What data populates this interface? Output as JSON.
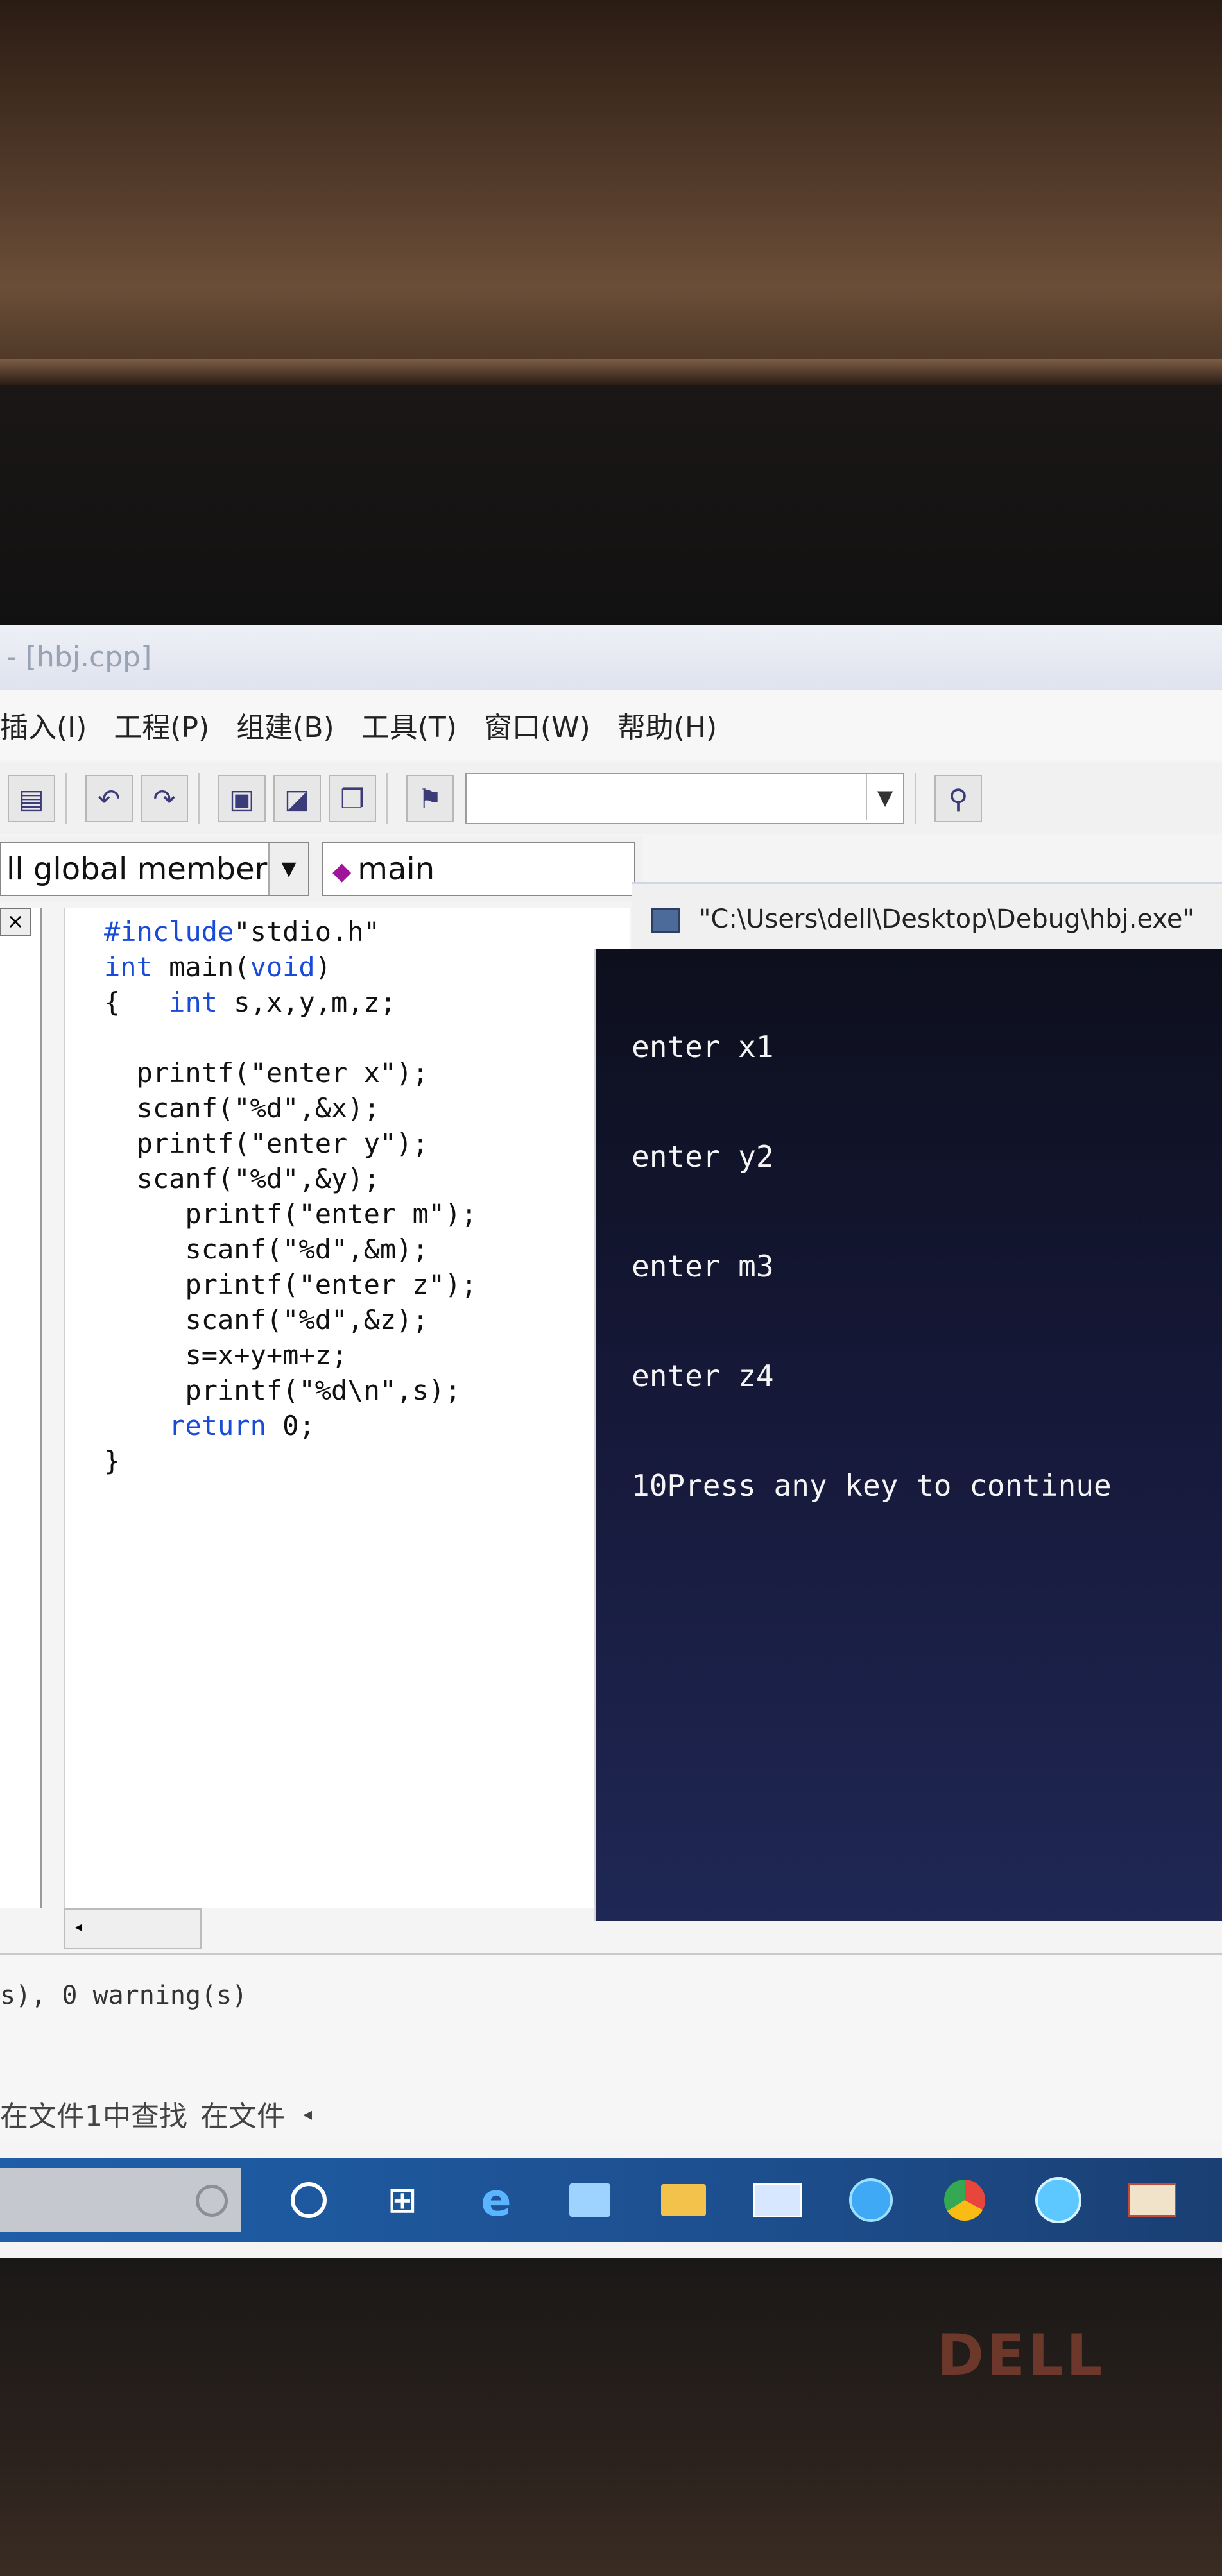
{
  "window": {
    "title": "- [hbj.cpp]"
  },
  "menubar": {
    "items": [
      "插入(I)",
      "工程(P)",
      "组建(B)",
      "工具(T)",
      "窗口(W)",
      "帮助(H)"
    ]
  },
  "toolbar": {
    "find_combo_value": "",
    "icons": [
      "file-icon",
      "undo-icon",
      "redo-icon",
      "workspace-icon",
      "output-icon",
      "window-list-icon",
      "find-in-files-icon",
      "find-icon"
    ]
  },
  "classbar": {
    "scope_value": "ll global members",
    "member_value": "main"
  },
  "editor": {
    "lines": [
      {
        "indent": 0,
        "parts": [
          {
            "t": "#include",
            "c": "pp"
          },
          {
            "t": "\"stdio.h\""
          }
        ]
      },
      {
        "indent": 0,
        "parts": [
          {
            "t": "int",
            "c": "kw"
          },
          {
            "t": " main("
          },
          {
            "t": "void",
            "c": "kw"
          },
          {
            "t": ")"
          }
        ]
      },
      {
        "indent": 0,
        "parts": [
          {
            "t": "{   "
          },
          {
            "t": "int",
            "c": "kw"
          },
          {
            "t": " s,x,y,m,z;"
          }
        ]
      },
      {
        "indent": 0,
        "parts": [
          {
            "t": ""
          }
        ]
      },
      {
        "indent": 1,
        "parts": [
          {
            "t": "printf(\"enter x\");"
          }
        ]
      },
      {
        "indent": 1,
        "parts": [
          {
            "t": "scanf(\"%d\",&x);"
          }
        ]
      },
      {
        "indent": 1,
        "parts": [
          {
            "t": "printf(\"enter y\");"
          }
        ]
      },
      {
        "indent": 1,
        "parts": [
          {
            "t": "scanf(\"%d\",&y);"
          }
        ]
      },
      {
        "indent": 2,
        "parts": [
          {
            "t": "printf(\"enter m\");"
          }
        ]
      },
      {
        "indent": 2,
        "parts": [
          {
            "t": "scanf(\"%d\",&m);"
          }
        ]
      },
      {
        "indent": 2,
        "parts": [
          {
            "t": "printf(\"enter z\");"
          }
        ]
      },
      {
        "indent": 2,
        "parts": [
          {
            "t": "scanf(\"%d\",&z);"
          }
        ]
      },
      {
        "indent": 2,
        "parts": [
          {
            "t": "s=x+y+m+z;"
          }
        ]
      },
      {
        "indent": 2,
        "parts": [
          {
            "t": "printf(\"%d\\n\",s);"
          }
        ]
      },
      {
        "indent": 3,
        "parts": [
          {
            "t": "return",
            "c": "kw"
          },
          {
            "t": " 0;"
          }
        ]
      },
      {
        "indent": 0,
        "parts": [
          {
            "t": "}"
          }
        ]
      }
    ]
  },
  "console": {
    "title": "\"C:\\Users\\dell\\Desktop\\Debug\\hbj.exe\"",
    "lines": [
      "enter x1",
      "enter y2",
      "enter m3",
      "enter z4",
      "10Press any key to continue"
    ]
  },
  "output": {
    "build_result": "s), 0 warning(s)",
    "tabs": [
      "在文件1中查找",
      "在文件"
    ]
  },
  "brand": {
    "laptop_logo": "DELL"
  },
  "colors": {
    "keyword": "#1a4bd8",
    "console_bg": "#16193a",
    "taskbar": "#1d4f8f"
  }
}
